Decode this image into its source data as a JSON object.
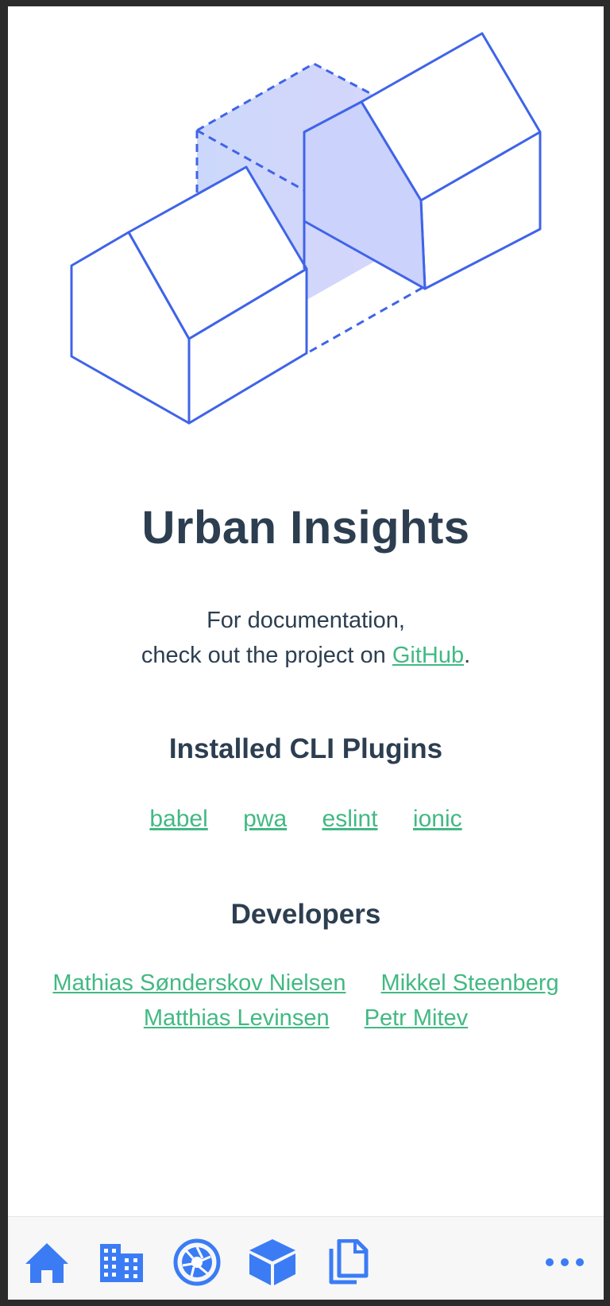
{
  "app": {
    "title": "Urban Insights",
    "doc_line1": "For documentation,",
    "doc_line2_prefix": "check out the project on",
    "doc_link": "GitHub",
    "doc_suffix": "."
  },
  "plugins": {
    "heading": "Installed CLI Plugins",
    "items": [
      "babel",
      "pwa",
      "eslint",
      "ionic"
    ]
  },
  "developers": {
    "heading": "Developers",
    "items": [
      "Mathias Sønderskov Nielsen",
      "Mikkel Steenberg",
      "Matthias Levinsen",
      "Petr Mitev"
    ]
  },
  "tabbar": {
    "tabs": [
      "home-icon",
      "building-icon",
      "camera-aperture-icon",
      "cube-icon",
      "documents-icon",
      "more-icon"
    ]
  },
  "colors": {
    "accent": "#3b7cf5",
    "link": "#42b983",
    "text": "#2c3e50",
    "illustration": "#3f64e8"
  }
}
